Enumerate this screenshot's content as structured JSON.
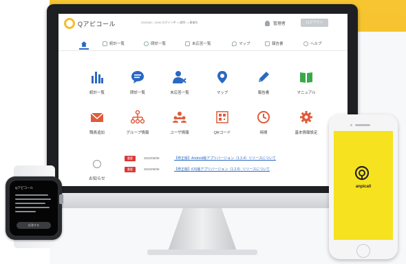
{
  "header": {
    "logo_text": "Qアピコール",
    "info_text": "2022/06/-- 15:00  ログイン中  ○○病院  ○○事業所",
    "user_name": "管理者",
    "logout_label": "ログアウト"
  },
  "nav": {
    "items": [
      {
        "label": "統計一覧",
        "icon": "chart-icon"
      },
      {
        "label": "問診一覧",
        "icon": "chat-icon"
      },
      {
        "label": "未応答一覧",
        "icon": "user-x-icon"
      },
      {
        "label": "マップ",
        "icon": "map-pin-icon"
      },
      {
        "label": "報告書",
        "icon": "pencil-icon"
      },
      {
        "label": "ヘルプ",
        "icon": "help-icon"
      }
    ]
  },
  "tiles": [
    {
      "label": "統計一覧",
      "icon": "bar-chart-icon",
      "color": "#2a68c4"
    },
    {
      "label": "問診一覧",
      "icon": "chat-bubble-icon",
      "color": "#2a68c4"
    },
    {
      "label": "未応答一覧",
      "icon": "user-x-icon",
      "color": "#2a68c4"
    },
    {
      "label": "マップ",
      "icon": "map-pin-icon",
      "color": "#2a68c4"
    },
    {
      "label": "報告書",
      "icon": "pencil-icon",
      "color": "#2a68c4"
    },
    {
      "label": "マニュアル",
      "icon": "book-icon",
      "color": "#3aa84a"
    },
    {
      "label": "職員追加",
      "icon": "envelope-icon",
      "color": "#e05a3a"
    },
    {
      "label": "グループ情報",
      "icon": "org-chart-icon",
      "color": "#e05a3a"
    },
    {
      "label": "ユーザ情報",
      "icon": "users-icon",
      "color": "#e05a3a"
    },
    {
      "label": "QRコード",
      "icon": "qr-code-icon",
      "color": "#e05a3a"
    },
    {
      "label": "時間",
      "icon": "clock-icon",
      "color": "#e05a3a"
    },
    {
      "label": "基本情報設定",
      "icon": "gear-icon",
      "color": "#e05a3a"
    }
  ],
  "notices": {
    "title": "お知らせ",
    "items": [
      {
        "badge": "重要",
        "date": "2022/06/08",
        "text": "【修正版】Android版アプリバージョン（1.2.4）リリースについて"
      },
      {
        "badge": "重要",
        "date": "2022/05/06",
        "text": "【修正版】iOS版アプリバージョン（1.2.5）リリースについて"
      }
    ]
  },
  "watch": {
    "title": "Qアピコール",
    "button_label": "応答する"
  },
  "phone": {
    "app_name": "anpicall"
  },
  "colors": {
    "brand_yellow": "#f4be28",
    "accent_blue": "#2a68c4",
    "alert_red": "#d93a3a"
  }
}
